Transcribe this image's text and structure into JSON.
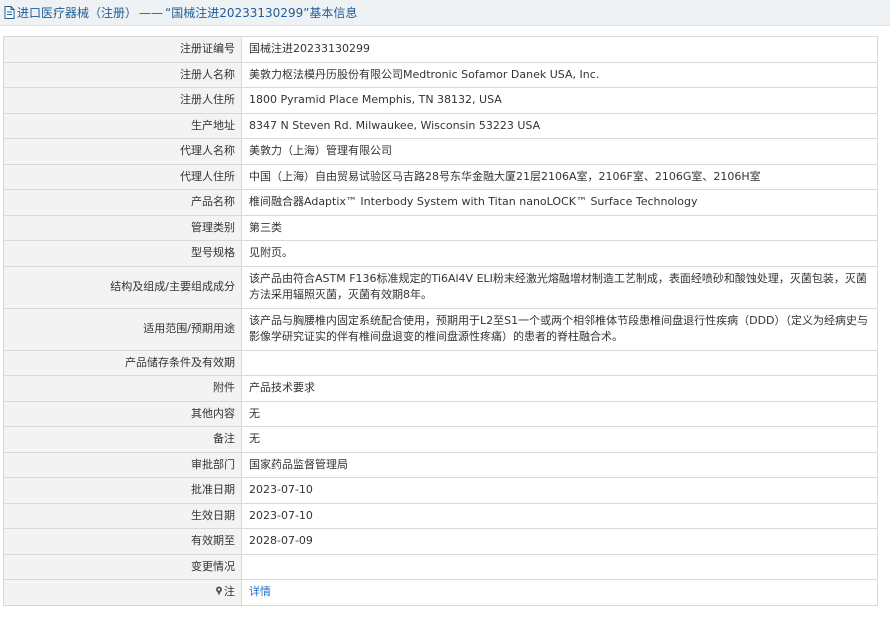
{
  "header": {
    "category": "进口医疗器械（注册）",
    "separator": "——",
    "title": "“国械注进20233130299”基本信息",
    "icon": "document-icon"
  },
  "rows": [
    {
      "label": "注册证编号",
      "value": "国械注进20233130299"
    },
    {
      "label": "注册人名称",
      "value": "美敦力枢法模丹历股份有限公司Medtronic Sofamor Danek USA, Inc."
    },
    {
      "label": "注册人住所",
      "value": "1800 Pyramid Place Memphis, TN 38132, USA"
    },
    {
      "label": "生产地址",
      "value": "8347 N Steven Rd. Milwaukee, Wisconsin 53223 USA"
    },
    {
      "label": "代理人名称",
      "value": "美敦力（上海）管理有限公司"
    },
    {
      "label": "代理人住所",
      "value": "中国（上海）自由贸易试验区马吉路28号东华金融大厦21层2106A室，2106F室、2106G室、2106H室"
    },
    {
      "label": "产品名称",
      "value": "椎间融合器Adaptix™ Interbody System with Titan nanoLOCK™ Surface Technology"
    },
    {
      "label": "管理类别",
      "value": "第三类"
    },
    {
      "label": "型号规格",
      "value": "见附页。"
    },
    {
      "label": "结构及组成/主要组成成分",
      "value": "该产品由符合ASTM F136标准规定的Ti6Al4V ELI粉末经激光熔融增材制造工艺制成，表面经喷砂和酸蚀处理，灭菌包装，灭菌方法采用辐照灭菌，灭菌有效期8年。"
    },
    {
      "label": "适用范围/预期用途",
      "value": "该产品与胸腰椎内固定系统配合使用，预期用于L2至S1一个或两个相邻椎体节段患椎间盘退行性疾病（DDD）（定义为经病史与影像学研究证实的伴有椎间盘退变的椎间盘源性疼痛）的患者的脊柱融合术。"
    },
    {
      "label": "产品储存条件及有效期",
      "value": ""
    },
    {
      "label": "附件",
      "value": "产品技术要求"
    },
    {
      "label": "其他内容",
      "value": "无"
    },
    {
      "label": "备注",
      "value": "无"
    },
    {
      "label": "审批部门",
      "value": "国家药品监督管理局"
    },
    {
      "label": "批准日期",
      "value": "2023-07-10"
    },
    {
      "label": "生效日期",
      "value": "2023-07-10"
    },
    {
      "label": "有效期至",
      "value": "2028-07-09"
    },
    {
      "label": "变更情况",
      "value": ""
    }
  ],
  "note": {
    "label": "注",
    "icon": "pin-icon",
    "link_text": "详情"
  },
  "colors": {
    "title_text": "#1f5c99",
    "title_bg": "#eef2f5",
    "label_bg": "#f3f3f3",
    "border": "#d9d9d9",
    "link": "#1f6fc5"
  }
}
